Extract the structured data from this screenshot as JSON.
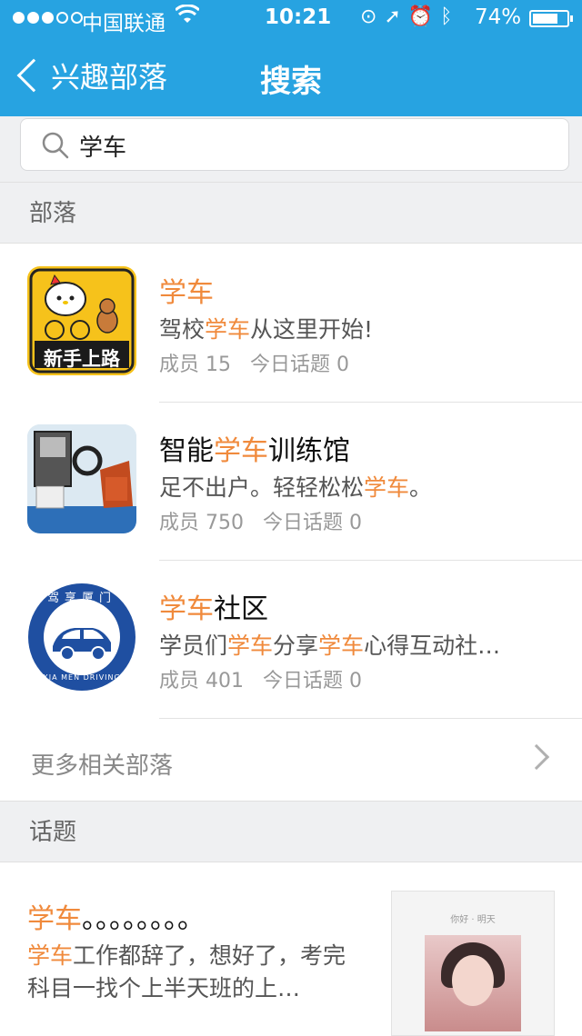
{
  "status_bar": {
    "carrier": "中国联通",
    "time": "10:21",
    "battery_percent": "74%",
    "battery_level": 0.74
  },
  "nav": {
    "back_label": "兴趣部落",
    "title": "搜索"
  },
  "search": {
    "query": "学车"
  },
  "sections": {
    "tribes_title": "部落",
    "topics_title": "话题"
  },
  "tribes": [
    {
      "name_pre": "",
      "name_hl": "学车",
      "name_post": "",
      "desc_pre": "驾校",
      "desc_hl": "学车",
      "desc_mid": "从这里开始!",
      "desc_hl2": "",
      "desc_post": "",
      "meta": "成员 15   今日话题 0",
      "avatar_text": "新手上路"
    },
    {
      "name_pre": "智能",
      "name_hl": "学车",
      "name_post": "训练馆",
      "desc_pre": "足不出户。轻轻松松",
      "desc_hl": "学车",
      "desc_mid": "。",
      "desc_hl2": "",
      "desc_post": "",
      "meta": "成员 750   今日话题 0"
    },
    {
      "name_pre": "",
      "name_hl": "学车",
      "name_post": "社区",
      "desc_pre": "学员们",
      "desc_hl": "学车",
      "desc_mid": "分享",
      "desc_hl2": "学车",
      "desc_post": "心得互动社…",
      "meta": "成员 401   今日话题 0",
      "avatar_top_text": "驾享厦门",
      "avatar_bottom_text": "XIA MEN DRIVING"
    }
  ],
  "more_tribes_label": "更多相关部落",
  "topic": {
    "title_hl": "学车",
    "title_post": "。。。。。。。。",
    "body_hl": "学车",
    "body_post": "工作都辞了，想好了，考完科目一找个上半天班的上…",
    "thumb_caption": "你好 · 明天"
  },
  "colors": {
    "header": "#27a3e1",
    "highlight": "#f08a3c",
    "section_bg": "#eff0f2"
  }
}
